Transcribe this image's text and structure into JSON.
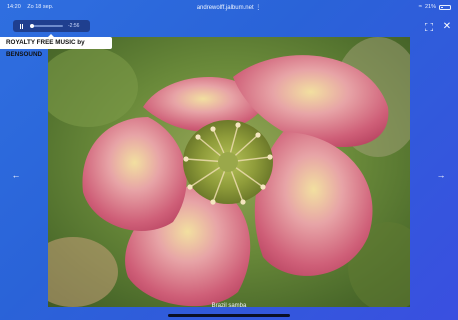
{
  "status_bar": {
    "time": "14:20",
    "date": "Zo 18 sep.",
    "url": "andrewolff.jalbum.net",
    "battery": "21%"
  },
  "player": {
    "time_remaining": "-2:56",
    "progress": 0.02
  },
  "music_label": "ROYALTY FREE MUSIC by BENSOUND",
  "photo": {
    "caption": "Brazil samba"
  },
  "icons": {
    "pause": "pause-icon",
    "expand": "expand-icon",
    "close": "close-icon",
    "prev": "chevron-left-icon",
    "next": "chevron-right-icon"
  },
  "colors": {
    "background": "#2f6fe0",
    "player_bg": "#1f3f8f",
    "label_bg": "#ffffff"
  }
}
